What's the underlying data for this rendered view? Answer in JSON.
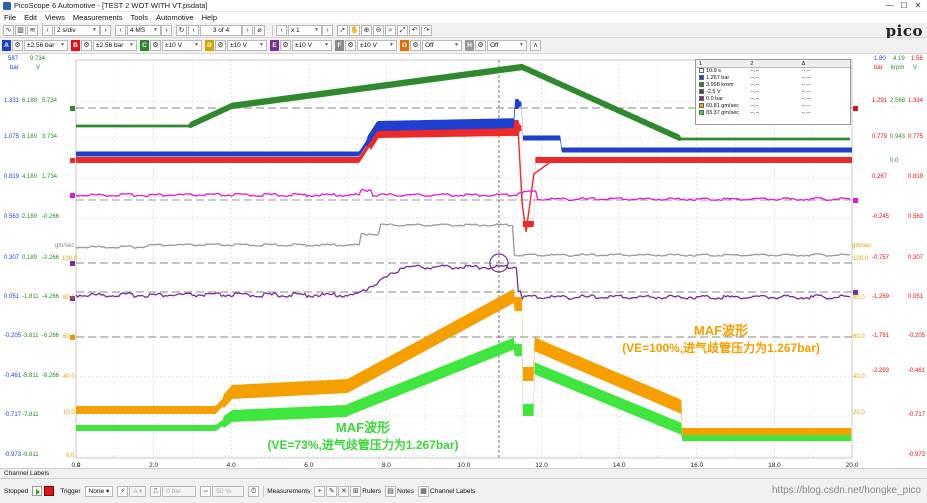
{
  "window": {
    "title": "PicoScope 6 Automotive - [TEST 2 WOT WITH VT.psdata]",
    "controls": [
      "—",
      "☐",
      "✕"
    ]
  },
  "menu": [
    "File",
    "Edit",
    "Views",
    "Measurements",
    "Tools",
    "Automotive",
    "Help"
  ],
  "logo": {
    "text": "pico",
    "sub": "Technology"
  },
  "toolbar1": {
    "timebase": "2 s/div",
    "samples": "4 MS",
    "buffer": "3 of 4",
    "zoom": "x 1"
  },
  "toolbar2": {
    "channels": [
      {
        "letter": "A",
        "color": "#1f3fd0",
        "range": "±2.56 bar"
      },
      {
        "letter": "B",
        "color": "#e0101a",
        "range": "±2.56 bar"
      },
      {
        "letter": "C",
        "color": "#2a8a2a",
        "range": "±10 V"
      },
      {
        "letter": "D",
        "color": "#d4a300",
        "range": "±10 V"
      },
      {
        "letter": "E",
        "color": "#7a2d9a",
        "range": "±10 V"
      },
      {
        "letter": "F",
        "color": "#8a8a8a",
        "range": "±10 V"
      },
      {
        "letter": "G",
        "color": "#e07000",
        "range": "Off"
      },
      {
        "letter": "H",
        "color": "#9a9a9a",
        "range": "Off"
      }
    ]
  },
  "scope": {
    "top_left_headers": [
      "587",
      "9.734",
      "bar",
      "V"
    ],
    "top_right_headers": [
      "1.80",
      "4.19",
      "1.58",
      "bar",
      "krpm",
      "V"
    ],
    "left_rows": [
      [
        "1.331",
        "6.189",
        "5.734"
      ],
      [
        "1.075",
        "6.189",
        "3.734"
      ],
      [
        "0.819",
        "4.189",
        "1.734"
      ],
      [
        "0.563",
        "2.189",
        "-0.266"
      ],
      [
        "0.307",
        "0.189",
        "-2.266"
      ],
      [
        "0.051",
        "-1.811",
        "-4.266"
      ],
      [
        "-0.205",
        "-3.811",
        "-6.266"
      ],
      [
        "-0.461",
        "-5.811",
        "-8.266"
      ],
      [
        "-0.717",
        "-7.811",
        ""
      ],
      [
        "-0.973",
        "-9.811",
        ""
      ]
    ],
    "right_rows": [
      [
        "1.291",
        "2.568",
        "1.334"
      ],
      [
        "0.779",
        "0.943",
        "0.775"
      ],
      [
        "",
        "0.0",
        ""
      ],
      [
        "0.267",
        "",
        "0.819"
      ],
      [
        "-0.245",
        "",
        "0.563"
      ],
      [
        "-0.757",
        "",
        "0.307"
      ],
      [
        "-1.269",
        "",
        "0.051"
      ],
      [
        "-1.781",
        "",
        "-0.205"
      ],
      [
        "-2.293",
        "",
        "-0.461"
      ],
      [
        "",
        "",
        "-0.717"
      ],
      [
        "",
        "",
        "-0.973"
      ]
    ],
    "mid_labels": {
      "gm_left": "gm/sec",
      "gm_right": "gm/sec",
      "v100": "100.0",
      "v80": "80.0",
      "v60": "60.0",
      "v40": "40.0",
      "v20": "20.0",
      "v10": "10.0",
      "v0": "0.0"
    },
    "x_ticks": [
      "0.0",
      "2.0",
      "4.0",
      "6.0",
      "8.0",
      "10.0",
      "12.0",
      "14.0",
      "16.0",
      "18.0",
      "20.0"
    ],
    "x_unit": "s",
    "annotations": {
      "orange_title": "MAF波形",
      "orange_sub": "(VE=100%,进气歧管压力为1.267bar)",
      "green_title": "MAF波形",
      "green_sub": "(VE=73%,进气歧管压力为1.267bar)"
    }
  },
  "measurements": {
    "headers": [
      "1",
      "2",
      "Δ"
    ],
    "rows": [
      {
        "color": "#ffffff",
        "v1": "10.9 s",
        "v2": "--.--",
        "d": "--.--"
      },
      {
        "color": "#1f3fd0",
        "v1": "1.267 bar",
        "v2": "--.--",
        "d": "--.--"
      },
      {
        "color": "#2a8a2a",
        "v1": "3.998 krom",
        "v2": "--.--",
        "d": "--.--"
      },
      {
        "color": "#444444",
        "v1": "-2.5 V",
        "v2": "--.--",
        "d": "--.--"
      },
      {
        "color": "#7a2d9a",
        "v1": "0.0 bar",
        "v2": "--.--",
        "d": "--.--"
      },
      {
        "color": "#f5a000",
        "v1": "60.81 gm/sec",
        "v2": "--.--",
        "d": "--.--"
      },
      {
        "color": "#39d839",
        "v1": "83.37 gm/sec",
        "v2": "--.--",
        "d": "--.--"
      }
    ]
  },
  "channel_labels": "Channel Labels",
  "status": {
    "state": "Stopped",
    "trigger_label": "Trigger",
    "trigger_mode": "None",
    "trigger_ch": "A",
    "threshold": "0 bar",
    "pretrigger": "50 %",
    "measurements": "Measurements",
    "rulers": "Rulers",
    "notes": "Notes",
    "channel_labels": "Channel Labels"
  },
  "watermark": "https://blog.csdn.net/hongke_pico"
}
